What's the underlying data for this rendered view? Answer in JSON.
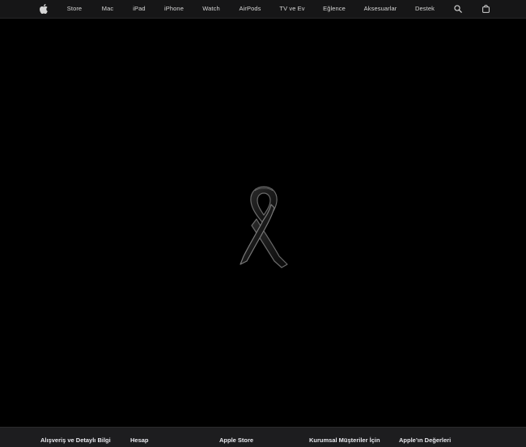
{
  "nav": {
    "apple_logo": "apple-icon",
    "items": [
      {
        "label": "Store"
      },
      {
        "label": "Mac"
      },
      {
        "label": "iPad"
      },
      {
        "label": "iPhone"
      },
      {
        "label": "Watch"
      },
      {
        "label": "AirPods"
      },
      {
        "label": "TV ve Ev"
      },
      {
        "label": "Eğlence"
      },
      {
        "label": "Aksesuarlar"
      },
      {
        "label": "Destek"
      }
    ],
    "search_icon": "search-icon",
    "bag_icon": "bag-icon"
  },
  "hero": {
    "image": "black-ribbon-icon"
  },
  "footer": {
    "columns": [
      {
        "label": "Alışveriş ve Detaylı Bilgi"
      },
      {
        "label": "Hesap"
      },
      {
        "label": "Apple Store"
      },
      {
        "label": "Kurumsal Müşteriler İçin"
      },
      {
        "label": "Apple’ın Değerleri"
      }
    ]
  },
  "colors": {
    "page_background": "#000000",
    "nav_background": "#161617",
    "nav_text": "#d6d6d6",
    "footer_background": "#1d1d1f",
    "footer_text": "#e8e8ed"
  }
}
